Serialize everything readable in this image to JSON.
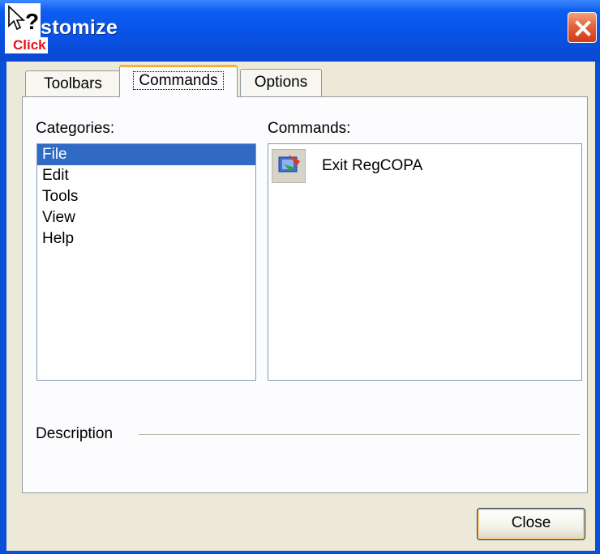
{
  "window": {
    "title": "stomize"
  },
  "cursor": {
    "label": "Click",
    "icon": "help-cursor-icon"
  },
  "tabs": [
    {
      "label": "Toolbars",
      "active": false
    },
    {
      "label": "Commands",
      "active": true
    },
    {
      "label": "Options",
      "active": false
    }
  ],
  "categories": {
    "label": "Categories:",
    "items": [
      "File",
      "Edit",
      "Tools",
      "View",
      "Help"
    ],
    "selected": "File"
  },
  "commands": {
    "label": "Commands:",
    "items": [
      {
        "label": "Exit RegCOPA",
        "icon": "exit-app-icon"
      }
    ]
  },
  "description": {
    "label": "Description"
  },
  "buttons": {
    "close": "Close"
  },
  "colors": {
    "titlebar": "#0a52e6",
    "selection": "#316ac5",
    "dialog_bg": "#ece9d8",
    "close_red": "#e4623b"
  }
}
